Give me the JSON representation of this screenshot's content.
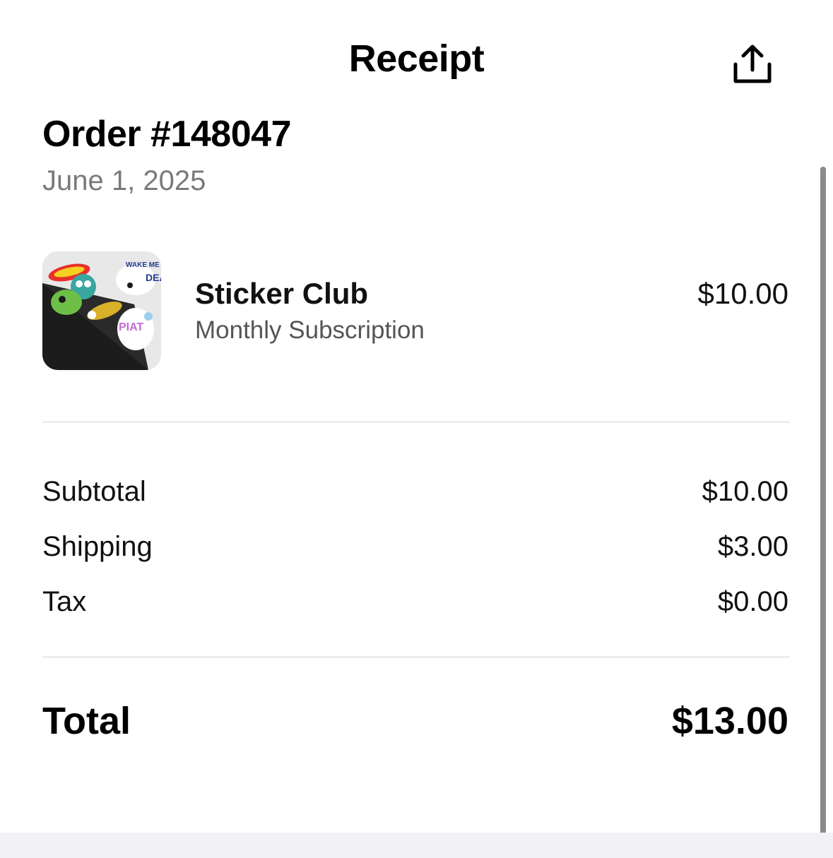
{
  "header": {
    "title": "Receipt",
    "share_icon": "share-icon"
  },
  "order": {
    "title": "Order #148047",
    "date": "June 1, 2025"
  },
  "item": {
    "name": "Sticker Club",
    "subtitle": "Monthly Subscription",
    "price": "$10.00",
    "thumbnail": "sticker-pack-thumbnail"
  },
  "summary": {
    "lines": [
      {
        "label": "Subtotal",
        "value": "$10.00"
      },
      {
        "label": "Shipping",
        "value": "$3.00"
      },
      {
        "label": "Tax",
        "value": "$0.00"
      }
    ],
    "total_label": "Total",
    "total_value": "$13.00"
  },
  "colors": {
    "text": "#000000",
    "muted": "#7a7a7a",
    "divider": "#eeeeee",
    "background": "#ffffff"
  }
}
